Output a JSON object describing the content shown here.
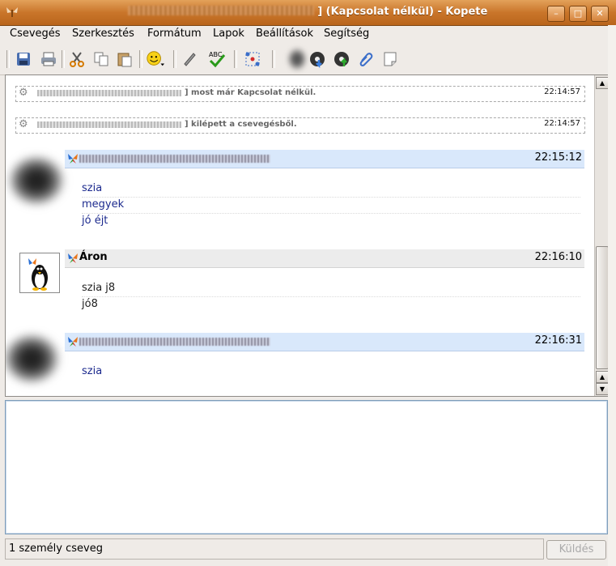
{
  "window": {
    "title_suffix": "] (Kapcsolat nélkül) - Kopete",
    "min": "–",
    "max": "□",
    "close": "✕"
  },
  "menu": [
    "Csevegés",
    "Szerkesztés",
    "Formátum",
    "Lapok",
    "Beállítások",
    "Segítség"
  ],
  "icons": [
    "save-icon",
    "print-icon",
    "cut-icon",
    "copy-icon",
    "paste-icon",
    "smiley-icon",
    "pen-icon",
    "spellcheck-icon",
    "members-icon",
    "send-file-icon",
    "receive-icon",
    "upload-icon",
    "attach-icon",
    "note-icon"
  ],
  "chat": {
    "system": [
      {
        "text": "] most már Kapcsolat nélkül.",
        "time": "22:14:57"
      },
      {
        "text": "] kilépett a csevegésből.",
        "time": "22:14:57"
      }
    ],
    "groups": [
      {
        "time": "22:15:12",
        "lines": [
          "szia",
          "megyek",
          "jó éjt"
        ]
      },
      {
        "name": "Áron",
        "time": "22:16:10",
        "lines": [
          "szia j8",
          "jó8"
        ]
      },
      {
        "time": "22:16:31",
        "lines": [
          "szia"
        ]
      }
    ]
  },
  "status": "1 személy cseveg",
  "send_label": "Küldés",
  "colors": {
    "title_bar": "#c9752a",
    "header_bg": "#d9e8fb",
    "message_text": "#1c2a8e"
  }
}
